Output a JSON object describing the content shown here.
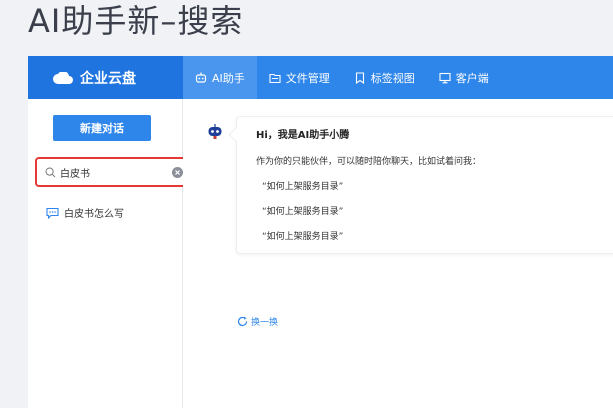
{
  "page": {
    "title": "AI助手新–搜索"
  },
  "brand": {
    "name": "企业云盘"
  },
  "nav": {
    "items": [
      {
        "label": "AI助手",
        "icon": "robot-icon",
        "active": true
      },
      {
        "label": "文件管理",
        "icon": "folder-icon",
        "active": false
      },
      {
        "label": "标签视图",
        "icon": "bookmark-icon",
        "active": false
      },
      {
        "label": "客户端",
        "icon": "monitor-icon",
        "active": false
      }
    ]
  },
  "sidebar": {
    "new_chat_label": "新建对话",
    "search": {
      "value": "白皮书",
      "placeholder": ""
    },
    "history": [
      {
        "label": "白皮书怎么写",
        "icon": "chat-bubble-icon"
      }
    ]
  },
  "chat": {
    "greeting": "Hi，我是AI助手小腾",
    "intro": "作为你的只能伙伴，可以随时陪你聊天，比如试着问我：",
    "examples": [
      "“如何上架服务目录”",
      "“如何上架服务目录”",
      "“如何上架服务目录”"
    ],
    "refresh_label": "换一换"
  },
  "colors": {
    "accent": "#2f86ea",
    "brand_bg": "#1f74e0",
    "highlight": "#e53935"
  }
}
